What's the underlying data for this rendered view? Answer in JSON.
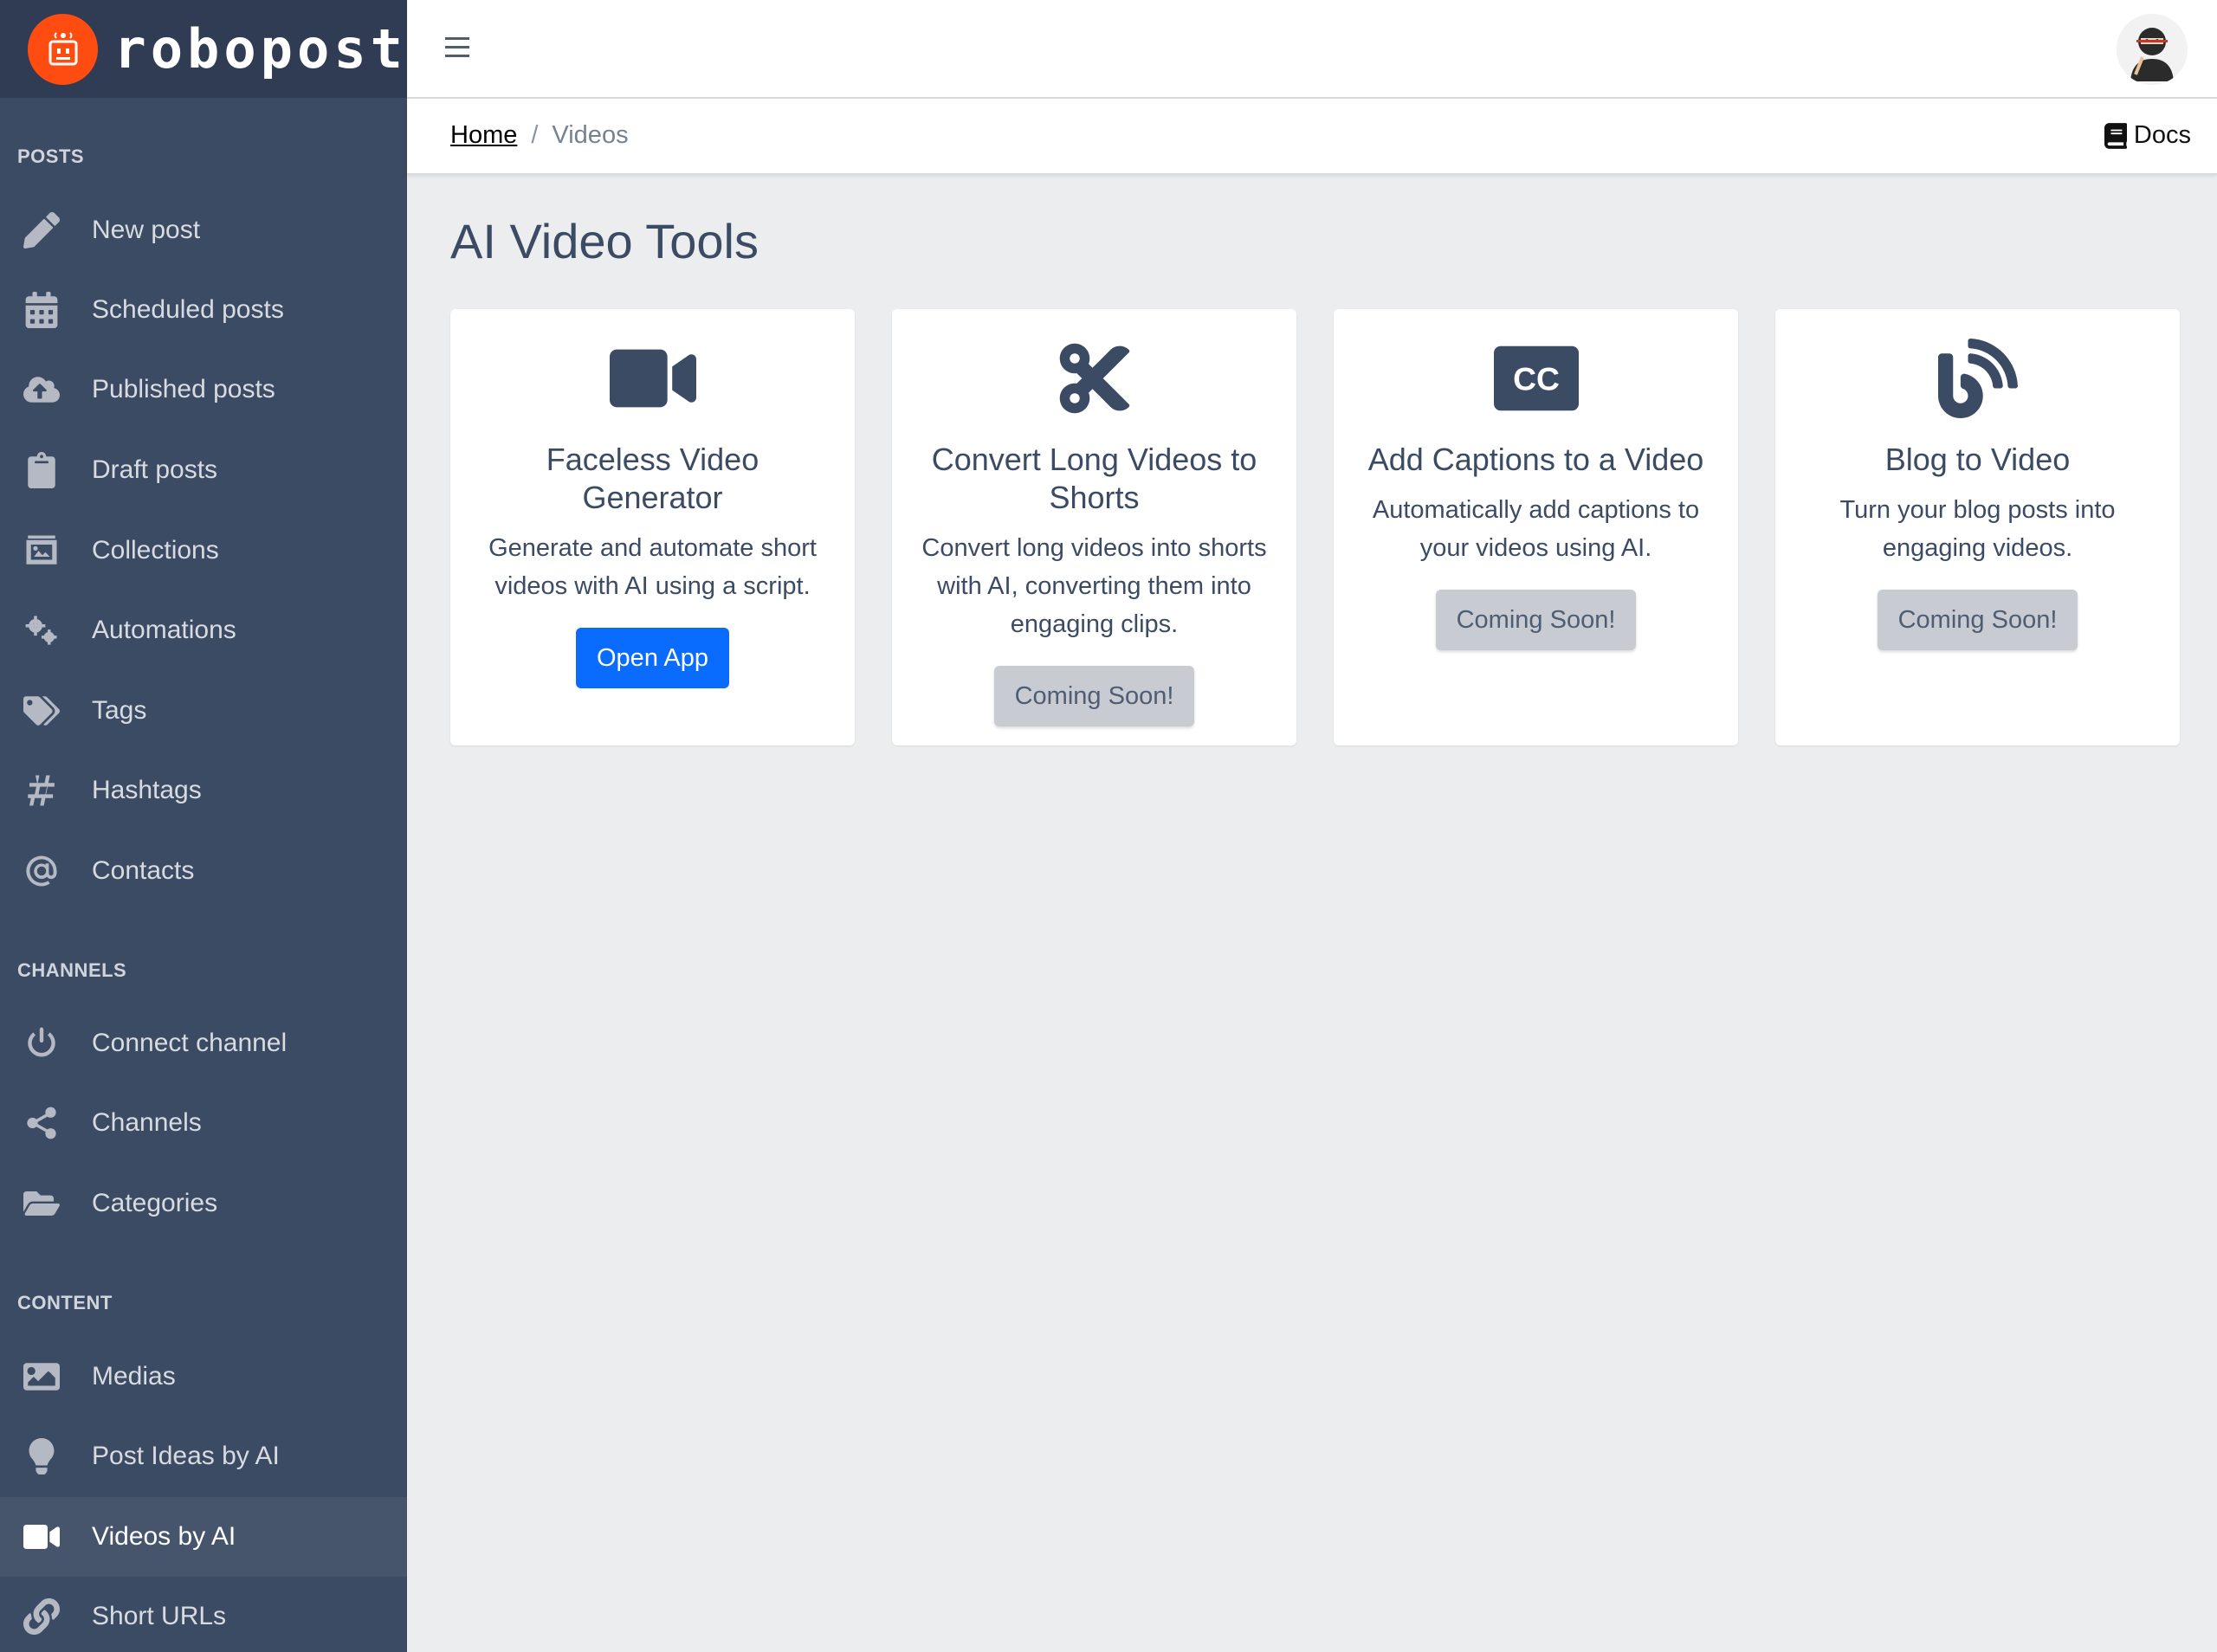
{
  "brand": {
    "name": "robopost"
  },
  "sidebar": {
    "sections": [
      {
        "title": "POSTS"
      },
      {
        "title": "CHANNELS"
      },
      {
        "title": "CONTENT"
      }
    ],
    "items": [
      {
        "label": "New post",
        "icon": "pencil-icon"
      },
      {
        "label": "Scheduled posts",
        "icon": "calendar-icon"
      },
      {
        "label": "Published posts",
        "icon": "cloud-upload-icon"
      },
      {
        "label": "Draft posts",
        "icon": "clipboard-icon"
      },
      {
        "label": "Collections",
        "icon": "collection-icon"
      },
      {
        "label": "Automations",
        "icon": "cogs-icon"
      },
      {
        "label": "Tags",
        "icon": "tags-icon"
      },
      {
        "label": "Hashtags",
        "icon": "hashtag-icon"
      },
      {
        "label": "Contacts",
        "icon": "at-icon"
      },
      {
        "label": "Connect channel",
        "icon": "power-icon"
      },
      {
        "label": "Channels",
        "icon": "share-icon"
      },
      {
        "label": "Categories",
        "icon": "folder-open-icon"
      },
      {
        "label": "Medias",
        "icon": "image-icon"
      },
      {
        "label": "Post Ideas by AI",
        "icon": "lightbulb-icon"
      },
      {
        "label": "Videos by AI",
        "icon": "video-icon",
        "active": true
      },
      {
        "label": "Short URLs",
        "icon": "link-icon"
      }
    ]
  },
  "header": {
    "breadcrumb": {
      "home": "Home",
      "separator": "/",
      "current": "Videos"
    },
    "docs_label": "Docs"
  },
  "main": {
    "title": "AI Video Tools",
    "cards": [
      {
        "icon": "video-camera-icon",
        "title": "Faceless Video Generator",
        "text": "Generate and automate short videos with AI using a script.",
        "button": "Open App",
        "button_style": "primary"
      },
      {
        "icon": "scissors-icon",
        "title": "Convert Long Videos to Shorts",
        "text": "Convert long videos into shorts with AI, converting them into engaging clips.",
        "button": "Coming Soon!",
        "button_style": "secondary"
      },
      {
        "icon": "closed-captioning-icon",
        "title": "Add Captions to a Video",
        "text": "Automatically add captions to your videos using AI.",
        "button": "Coming Soon!",
        "button_style": "secondary"
      },
      {
        "icon": "blog-icon",
        "title": "Blog to Video",
        "text": "Turn your blog posts into engaging videos.",
        "button": "Coming Soon!",
        "button_style": "secondary"
      }
    ]
  },
  "colors": {
    "sidebar_bg": "#3c4b64",
    "primary_button": "#0a6cff",
    "brand_orange": "#ff4d12"
  }
}
